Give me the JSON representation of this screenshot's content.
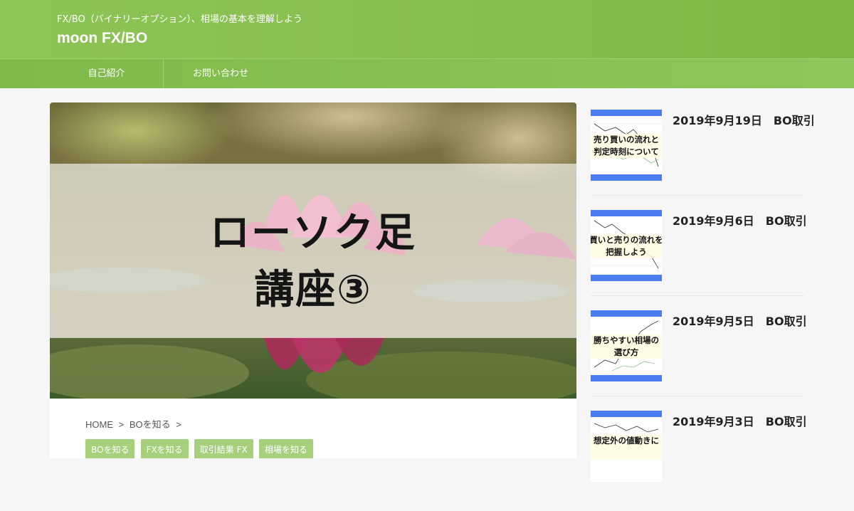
{
  "header": {
    "tagline": "FX/BO（バイナリーオプション）、相場の基本を理解しよう",
    "site_title": "moon FX/BO"
  },
  "nav": {
    "items": [
      {
        "label": "自己紹介"
      },
      {
        "label": "お問い合わせ"
      }
    ]
  },
  "hero": {
    "title_line1": "ローソク足",
    "title_line2": "講座③"
  },
  "breadcrumb": {
    "home": "HOME",
    "sep": ">",
    "category": "BOを知る"
  },
  "tags": [
    "BOを知る",
    "FXを知る",
    "取引結果 FX",
    "相場を知る"
  ],
  "sidebar": {
    "posts": [
      {
        "title": "2019年9月19日　BO取引",
        "thumb_lines": [
          "売り買いの流れと",
          "判定時刻について"
        ]
      },
      {
        "title": "2019年9月6日　BO取引",
        "thumb_lines": [
          "買いと売りの流れを",
          "把握しよう"
        ]
      },
      {
        "title": "2019年9月5日　BO取引",
        "thumb_lines": [
          "勝ちやすい相場の",
          "選び方"
        ]
      },
      {
        "title": "2019年9月3日　BO取引",
        "thumb_lines": [
          "想定外の値動きに",
          ""
        ]
      }
    ]
  },
  "colors": {
    "header_green": "#86be4e",
    "tag_green": "#a6d07c",
    "thumb_blue": "#4c7cf0"
  }
}
